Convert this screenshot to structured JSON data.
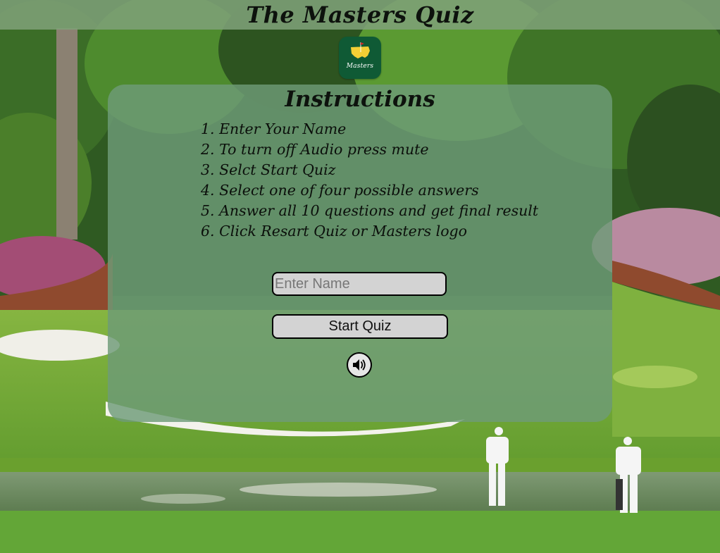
{
  "header": {
    "title": "The Masters Quiz"
  },
  "logo": {
    "text": "Masters",
    "icon": "masters-logo-icon"
  },
  "instructions": {
    "title": "Instructions",
    "steps": [
      "1. Enter Your Name",
      "2. To turn off Audio press mute",
      "3. Selct Start Quiz",
      "4. Select one of four possible answers",
      "5. Answer all 10 questions and get final result",
      "6. Click Resart Quiz or Masters logo"
    ]
  },
  "form": {
    "name_placeholder": "Enter Name",
    "name_value": "",
    "start_label": "Start Quiz"
  },
  "audio": {
    "icon": "speaker-icon",
    "muted": false
  },
  "colors": {
    "header_bg": "#7ea078",
    "panel_bg": "#6e9b78",
    "logo_bg": "#0f5a35",
    "input_bg": "#d3d3d3"
  }
}
